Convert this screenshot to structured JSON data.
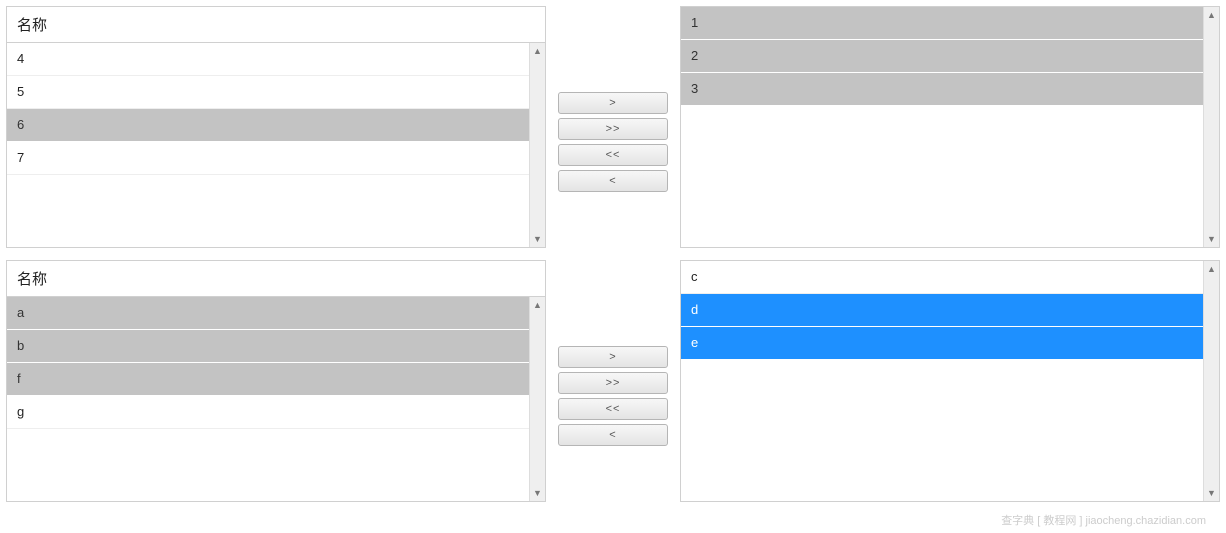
{
  "transfers": [
    {
      "left": {
        "header": "名称",
        "items": [
          {
            "label": "4",
            "state": "normal"
          },
          {
            "label": "5",
            "state": "normal"
          },
          {
            "label": "6",
            "state": "grayed"
          },
          {
            "label": "7",
            "state": "normal"
          }
        ]
      },
      "right": {
        "items": [
          {
            "label": "1",
            "state": "grayed"
          },
          {
            "label": "2",
            "state": "grayed"
          },
          {
            "label": "3",
            "state": "grayed"
          }
        ]
      }
    },
    {
      "left": {
        "header": "名称",
        "items": [
          {
            "label": "a",
            "state": "grayed"
          },
          {
            "label": "b",
            "state": "grayed"
          },
          {
            "label": "f",
            "state": "grayed"
          },
          {
            "label": "g",
            "state": "normal"
          }
        ]
      },
      "right": {
        "items": [
          {
            "label": "c",
            "state": "normal"
          },
          {
            "label": "d",
            "state": "blue"
          },
          {
            "label": "e",
            "state": "blue"
          }
        ]
      }
    }
  ],
  "buttons": {
    "move_right": ">",
    "move_all_right": ">>",
    "move_all_left": "<<",
    "move_left": "<"
  },
  "watermark": "查字典 [ 教程网 ]  jiaocheng.chazidian.com"
}
